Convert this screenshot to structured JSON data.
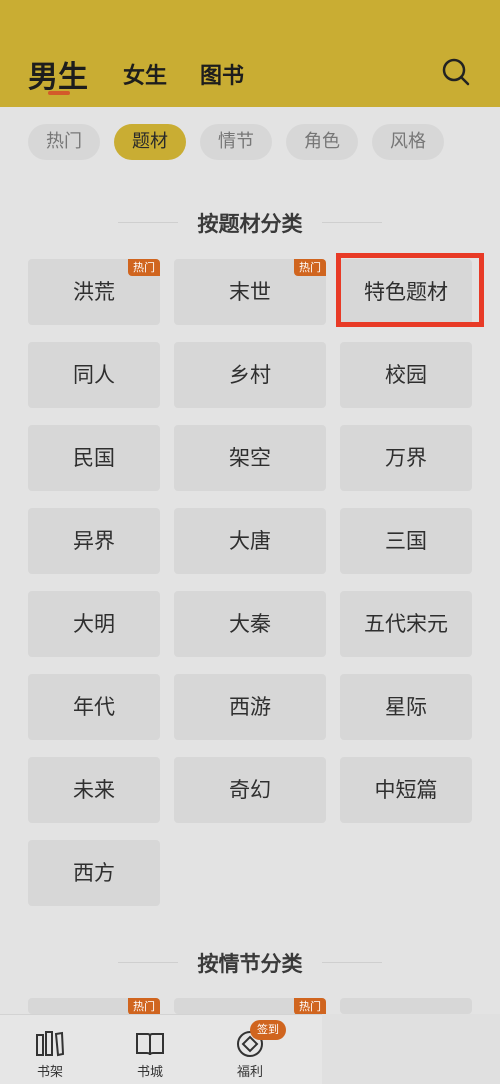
{
  "header": {
    "tabs": [
      "男生",
      "女生",
      "图书"
    ],
    "search_icon": "search-icon"
  },
  "chips": [
    "热门",
    "题材",
    "情节",
    "角色",
    "风格"
  ],
  "active_chip": "题材",
  "section_theme": {
    "title": "按题材分类",
    "items": [
      {
        "label": "洪荒",
        "badge": "热门"
      },
      {
        "label": "末世",
        "badge": "热门"
      },
      {
        "label": "特色题材",
        "badge": ""
      },
      {
        "label": "同人",
        "badge": ""
      },
      {
        "label": "乡村",
        "badge": ""
      },
      {
        "label": "校园",
        "badge": ""
      },
      {
        "label": "民国",
        "badge": ""
      },
      {
        "label": "架空",
        "badge": ""
      },
      {
        "label": "万界",
        "badge": ""
      },
      {
        "label": "异界",
        "badge": ""
      },
      {
        "label": "大唐",
        "badge": ""
      },
      {
        "label": "三国",
        "badge": ""
      },
      {
        "label": "大明",
        "badge": ""
      },
      {
        "label": "大秦",
        "badge": ""
      },
      {
        "label": "五代宋元",
        "badge": ""
      },
      {
        "label": "年代",
        "badge": ""
      },
      {
        "label": "西游",
        "badge": ""
      },
      {
        "label": "星际",
        "badge": ""
      },
      {
        "label": "未来",
        "badge": ""
      },
      {
        "label": "奇幻",
        "badge": ""
      },
      {
        "label": "中短篇",
        "badge": ""
      },
      {
        "label": "西方",
        "badge": ""
      }
    ]
  },
  "section_plot": {
    "title": "按情节分类",
    "badges": [
      "热门",
      "热门"
    ]
  },
  "highlighted_item": "特色题材",
  "bottom_nav": {
    "items": [
      {
        "label": "书架",
        "icon": "bookshelf-icon"
      },
      {
        "label": "书城",
        "icon": "book-icon"
      },
      {
        "label": "福利",
        "icon": "gift-icon"
      }
    ],
    "sign_badge": "签到"
  },
  "colors": {
    "header_bg": "#c9ad33",
    "badge": "#d0651f",
    "highlight_border": "#e83a26"
  }
}
